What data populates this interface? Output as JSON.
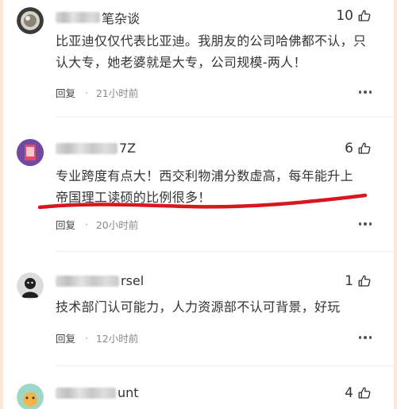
{
  "comments": [
    {
      "username_visible": "笔杂谈",
      "likes": "10",
      "text": "比亚迪仅仅代表比亚迪。我朋友的公司哈佛都不认，只认大专，她老婆就是大专，公司规模-两人！",
      "reply_label": "回复",
      "separator": "·",
      "time": "21小时前"
    },
    {
      "username_visible": "7Z",
      "likes": "6",
      "text": "专业跨度有点大！西交利物浦分数虚高，每年能升上\n帝国理工读硕的比例很多！",
      "reply_label": "回复",
      "separator": "·",
      "time": "20小时前"
    },
    {
      "username_visible": "rsel",
      "likes": "1",
      "text": "技术部门认可能力，人力资源部不认可背景，好玩",
      "reply_label": "回复",
      "separator": "·",
      "time": "12小时前"
    },
    {
      "username_visible": "unt",
      "likes": "4"
    }
  ],
  "colors": {
    "outer_background": "#fde7d8",
    "annotation_underline": "#d9151e"
  },
  "icons": [
    "thumbs-up-icon",
    "more-options-icon"
  ]
}
